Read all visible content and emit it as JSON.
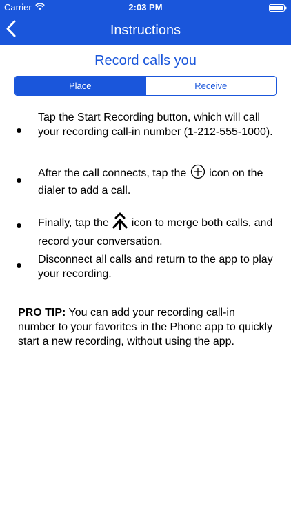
{
  "status_bar": {
    "carrier": "Carrier",
    "time": "2:03 PM"
  },
  "nav": {
    "title": "Instructions",
    "back_icon": "chevron-left-icon"
  },
  "heading": "Record calls you",
  "segments": {
    "place": "Place",
    "receive": "Receive",
    "selected": "Place"
  },
  "steps": {
    "step1": "Tap the Start Recording button, which will call your recording call-in number (1-212-555-1000).",
    "step2_a": "After the call connects, tap the",
    "step2_b": "icon on the dialer to add a call.",
    "step3_a": "Finally, tap the",
    "step3_b": "icon to merge both calls, and record your conversation.",
    "step4": "Disconnect all calls and return to the app to play your recording."
  },
  "pro_tip": {
    "label": "PRO TIP:",
    "text": "You can add your recording call-in number to your favorites in the Phone app to quickly start a new recording, without using the app."
  },
  "colors": {
    "brand_blue": "#1a56db",
    "background": "#ffffff",
    "text": "#000000"
  },
  "icons": [
    "wifi-icon",
    "battery-icon",
    "chevron-left-icon",
    "plus-circle-icon",
    "merge-icon"
  ]
}
